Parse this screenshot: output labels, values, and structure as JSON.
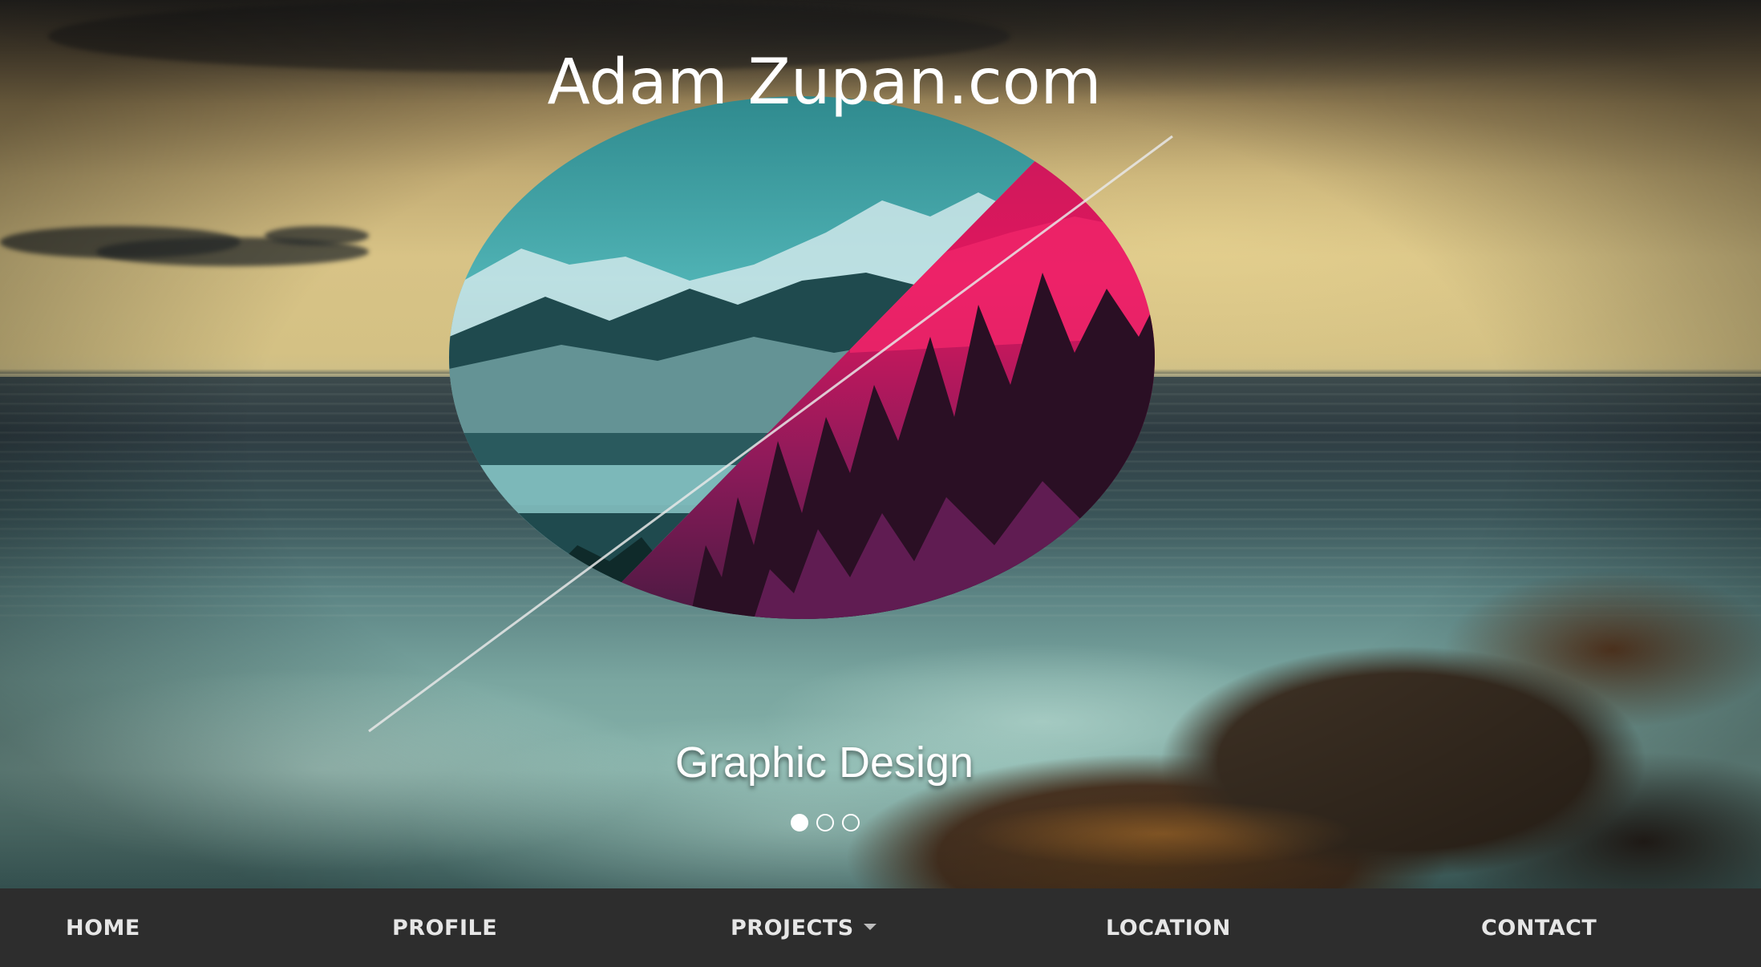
{
  "site": {
    "title": "Adam Zupan.com"
  },
  "slider": {
    "caption": "Graphic Design",
    "slide_count": 3,
    "active_slide": 1
  },
  "nav": {
    "items": [
      {
        "label": "HOME",
        "has_dropdown": false
      },
      {
        "label": "PROFILE",
        "has_dropdown": false
      },
      {
        "label": "PROJECTS",
        "has_dropdown": true
      },
      {
        "label": "LOCATION",
        "has_dropdown": false
      },
      {
        "label": "CONTACT",
        "has_dropdown": false
      }
    ]
  },
  "colors": {
    "navbar_bg": "#2d2d2d",
    "nav_text": "#e6e6e6",
    "oval_teal": "#3c9ea0",
    "oval_magenta": "#e0165e",
    "oval_purple": "#5a1a4a"
  },
  "icons": {
    "dropdown_caret": "caret-down-icon"
  }
}
